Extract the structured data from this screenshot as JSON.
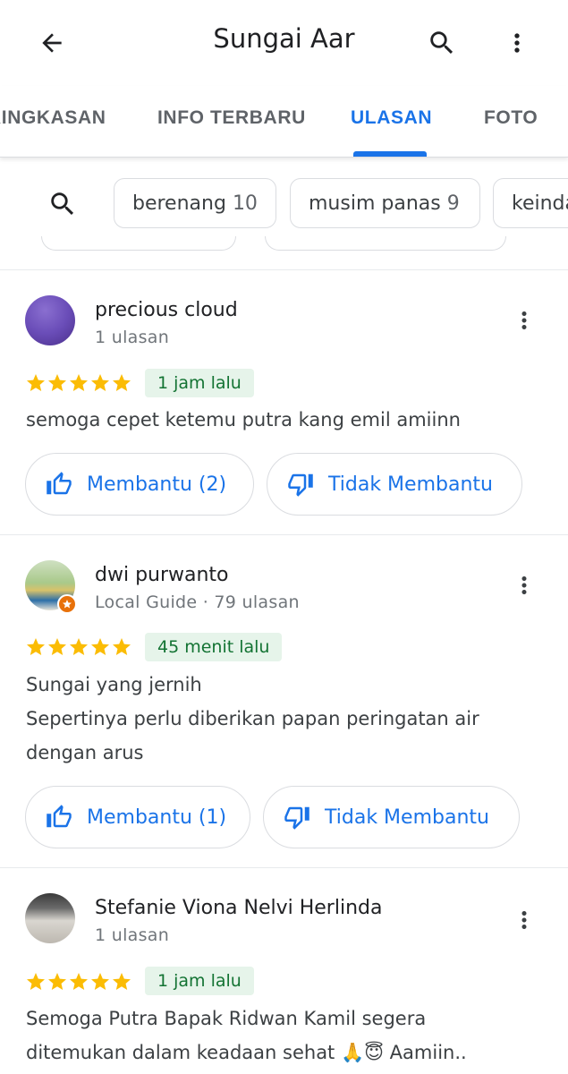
{
  "header": {
    "title": "Sungai Aar"
  },
  "tabs": [
    {
      "label": "RINGKASAN"
    },
    {
      "label": "INFO TERBARU"
    },
    {
      "label": "ULASAN"
    },
    {
      "label": "FOTO"
    }
  ],
  "chips": [
    {
      "label": "berenang",
      "count": "10"
    },
    {
      "label": "musim panas",
      "count": "9"
    },
    {
      "label": "keindahan",
      "count": ""
    }
  ],
  "reviews": [
    {
      "name": "precious cloud",
      "meta": "1 ulasan",
      "rating": 5,
      "time": "1 jam lalu",
      "text": [
        "semoga cepet ketemu putra kang emil amiinn"
      ],
      "helpful": "Membantu (2)",
      "not_helpful": "Tidak Membantu"
    },
    {
      "name": "dwi purwanto",
      "meta": "Local Guide · 79 ulasan",
      "rating": 5,
      "time": "45 menit lalu",
      "text": [
        "Sungai yang jernih",
        "Sepertinya perlu diberikan papan peringatan air",
        "dengan arus"
      ],
      "helpful": "Membantu (1)",
      "not_helpful": "Tidak Membantu"
    },
    {
      "name": "Stefanie Viona Nelvi Herlinda",
      "meta": "1 ulasan",
      "rating": 5,
      "time": "1 jam lalu",
      "text": [
        "Semoga Putra Bapak Ridwan Kamil segera",
        "ditemukan dalam keadaan sehat 🙏😇 Aamiin.."
      ]
    }
  ],
  "colors": {
    "accent": "#1a73e8",
    "star": "#fbbc04",
    "badge_bg": "#e6f4ea",
    "badge_text": "#137333"
  }
}
